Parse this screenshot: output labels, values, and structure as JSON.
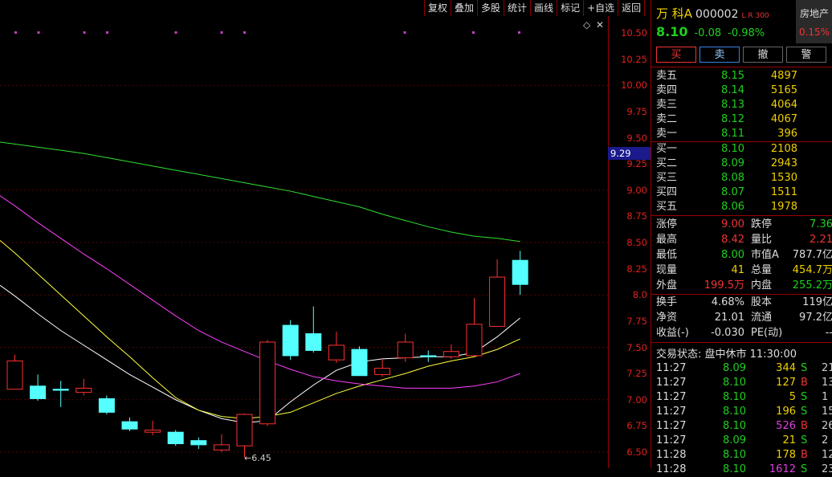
{
  "toolbar": {
    "items": [
      "复权",
      "叠加",
      "多股",
      "统计",
      "画线",
      "标记",
      "+自选",
      "返回"
    ]
  },
  "chart_controls": {
    "diamond": "◇",
    "close": "✕"
  },
  "price_axis": {
    "ticks": [
      "10.50",
      "10.25",
      "10.00",
      "9.75",
      "9.50",
      "9.25",
      "9.00",
      "8.75",
      "8.50",
      "8.25",
      "8.0",
      "7.75",
      "7.50",
      "7.25",
      "7.00",
      "6.75",
      "6.50"
    ],
    "current_label": "9.29"
  },
  "chart_data": {
    "type": "candlestick",
    "y_range": [
      6.45,
      10.6
    ],
    "candles": [
      {
        "o": 7.1,
        "c": 7.37,
        "h": 7.43,
        "l": 7.1
      },
      {
        "o": 7.13,
        "c": 7.01,
        "h": 7.24,
        "l": 6.99
      },
      {
        "o": 7.1,
        "c": 7.09,
        "h": 7.18,
        "l": 6.93
      },
      {
        "o": 7.07,
        "c": 7.11,
        "h": 7.2,
        "l": 7.04
      },
      {
        "o": 7.01,
        "c": 6.88,
        "h": 7.04,
        "l": 6.86
      },
      {
        "o": 6.79,
        "c": 6.72,
        "h": 6.83,
        "l": 6.7
      },
      {
        "o": 6.69,
        "c": 6.71,
        "h": 6.8,
        "l": 6.66
      },
      {
        "o": 6.69,
        "c": 6.58,
        "h": 6.71,
        "l": 6.56
      },
      {
        "o": 6.61,
        "c": 6.57,
        "h": 6.64,
        "l": 6.53
      },
      {
        "o": 6.52,
        "c": 6.57,
        "h": 6.67,
        "l": 6.5
      },
      {
        "o": 6.56,
        "c": 6.86,
        "h": 6.87,
        "l": 6.45
      },
      {
        "o": 6.77,
        "c": 7.55,
        "h": 7.57,
        "l": 6.75
      },
      {
        "o": 7.71,
        "c": 7.42,
        "h": 7.76,
        "l": 7.38
      },
      {
        "o": 7.63,
        "c": 7.47,
        "h": 7.89,
        "l": 7.45
      },
      {
        "o": 7.38,
        "c": 7.52,
        "h": 7.65,
        "l": 7.35
      },
      {
        "o": 7.48,
        "c": 7.23,
        "h": 7.51,
        "l": 7.23
      },
      {
        "o": 7.24,
        "c": 7.3,
        "h": 7.39,
        "l": 7.22
      },
      {
        "o": 7.4,
        "c": 7.55,
        "h": 7.63,
        "l": 7.36
      },
      {
        "o": 7.42,
        "c": 7.41,
        "h": 7.47,
        "l": 7.36
      },
      {
        "o": 7.41,
        "c": 7.46,
        "h": 7.53,
        "l": 7.39
      },
      {
        "o": 7.42,
        "c": 7.72,
        "h": 7.97,
        "l": 7.42
      },
      {
        "o": 7.7,
        "c": 8.17,
        "h": 8.34,
        "l": 7.7
      },
      {
        "o": 8.33,
        "c": 8.1,
        "h": 8.42,
        "l": 8.0
      }
    ],
    "ma_lines": [
      {
        "color": "#ffffff",
        "values": [
          7.99,
          7.82,
          7.66,
          7.52,
          7.38,
          7.24,
          7.12,
          7.0,
          6.9,
          6.82,
          6.78,
          6.8,
          6.98,
          7.14,
          7.28,
          7.36,
          7.39,
          7.4,
          7.41,
          7.41,
          7.45,
          7.6,
          7.78
        ]
      },
      {
        "color": "#ffff40",
        "values": [
          8.4,
          8.2,
          8.0,
          7.8,
          7.6,
          7.41,
          7.21,
          7.02,
          6.9,
          6.84,
          6.82,
          6.84,
          6.88,
          6.97,
          7.06,
          7.13,
          7.19,
          7.25,
          7.32,
          7.37,
          7.41,
          7.48,
          7.58
        ]
      },
      {
        "color": "#ff40ff",
        "values": [
          8.85,
          8.69,
          8.54,
          8.39,
          8.25,
          8.1,
          7.95,
          7.8,
          7.66,
          7.55,
          7.46,
          7.37,
          7.29,
          7.22,
          7.18,
          7.15,
          7.13,
          7.11,
          7.11,
          7.11,
          7.13,
          7.17,
          7.25
        ]
      },
      {
        "color": "#30e030",
        "values": [
          9.44,
          9.41,
          9.38,
          9.35,
          9.31,
          9.27,
          9.23,
          9.19,
          9.15,
          9.11,
          9.07,
          9.03,
          8.99,
          8.94,
          8.89,
          8.84,
          8.77,
          8.71,
          8.65,
          8.6,
          8.56,
          8.54,
          8.51
        ]
      }
    ],
    "low_marker": "6.45"
  },
  "stock": {
    "name": "万 科A",
    "code": "000002",
    "flags": "L R 300",
    "sector": "房地产",
    "sector_change": "0.15%",
    "price": "8.10",
    "change": "-0.08",
    "change_pct": "-0.98%"
  },
  "trade_buttons": [
    "买",
    "卖",
    "撤",
    "警"
  ],
  "order_book": [
    {
      "label": "卖五",
      "price": "8.15",
      "vol": "4897",
      "color": "#1fd01f"
    },
    {
      "label": "卖四",
      "price": "8.14",
      "vol": "5165",
      "color": "#1fd01f"
    },
    {
      "label": "卖三",
      "price": "8.13",
      "vol": "4064",
      "color": "#1fd01f"
    },
    {
      "label": "卖二",
      "price": "8.12",
      "vol": "4067",
      "color": "#1fd01f"
    },
    {
      "label": "卖一",
      "price": "8.11",
      "vol": "396",
      "color": "#1fd01f"
    },
    {
      "label": "买一",
      "price": "8.10",
      "vol": "2108",
      "color": "#1fd01f"
    },
    {
      "label": "买二",
      "price": "8.09",
      "vol": "2943",
      "color": "#1fd01f"
    },
    {
      "label": "买三",
      "price": "8.08",
      "vol": "1530",
      "color": "#1fd01f"
    },
    {
      "label": "买四",
      "price": "8.07",
      "vol": "1511",
      "color": "#1fd01f"
    },
    {
      "label": "买五",
      "price": "8.06",
      "vol": "1978",
      "color": "#1fd01f"
    }
  ],
  "stats_a": [
    {
      "l1": "涨停",
      "v1": "9.00",
      "c1": "#e33",
      "l2": "跌停",
      "v2": "7.36",
      "c2": "#1fd01f"
    },
    {
      "l1": "最高",
      "v1": "8.42",
      "c1": "#e33",
      "l2": "量比",
      "v2": "2.21",
      "c2": "#e33"
    },
    {
      "l1": "最低",
      "v1": "8.00",
      "c1": "#1fd01f",
      "l2": "市值A",
      "v2": "787.7亿",
      "c2": "#ddd"
    },
    {
      "l1": "现量",
      "v1": "41",
      "c1": "#f0d000",
      "l2": "总量",
      "v2": "454.7万",
      "c2": "#f0d000"
    },
    {
      "l1": "外盘",
      "v1": "199.5万",
      "c1": "#e33",
      "l2": "内盘",
      "v2": "255.2万",
      "c2": "#1fd01f"
    }
  ],
  "stats_b": [
    {
      "l1": "换手",
      "v1": "4.68%",
      "c1": "#ddd",
      "l2": "股本",
      "v2": "119亿",
      "c2": "#ddd"
    },
    {
      "l1": "净资",
      "v1": "21.01",
      "c1": "#ddd",
      "l2": "流通",
      "v2": "97.2亿",
      "c2": "#ddd"
    },
    {
      "l1": "收益(-)",
      "v1": "-0.030",
      "c1": "#ddd",
      "l2": "PE(动)",
      "v2": "--",
      "c2": "#ddd"
    }
  ],
  "trade_status": "交易状态: 盘中休市 11:30:00",
  "ticks": [
    {
      "time": "11:27",
      "price": "8.09",
      "vol": "344",
      "side": "S",
      "cnt": "21",
      "pc": "#1fd01f",
      "vc": "#f0d000",
      "sc": "#1fd01f"
    },
    {
      "time": "11:27",
      "price": "8.10",
      "vol": "127",
      "side": "B",
      "cnt": "13",
      "pc": "#1fd01f",
      "vc": "#f0d000",
      "sc": "#e33"
    },
    {
      "time": "11:27",
      "price": "8.10",
      "vol": "5",
      "side": "S",
      "cnt": "1",
      "pc": "#1fd01f",
      "vc": "#f0d000",
      "sc": "#1fd01f"
    },
    {
      "time": "11:27",
      "price": "8.10",
      "vol": "196",
      "side": "S",
      "cnt": "15",
      "pc": "#1fd01f",
      "vc": "#f0d000",
      "sc": "#1fd01f"
    },
    {
      "time": "11:27",
      "price": "8.10",
      "vol": "526",
      "side": "B",
      "cnt": "26",
      "pc": "#1fd01f",
      "vc": "#e040e0",
      "sc": "#e33"
    },
    {
      "time": "11:27",
      "price": "8.09",
      "vol": "21",
      "side": "S",
      "cnt": "2",
      "pc": "#1fd01f",
      "vc": "#f0d000",
      "sc": "#1fd01f"
    },
    {
      "time": "11:28",
      "price": "8.10",
      "vol": "178",
      "side": "B",
      "cnt": "12",
      "pc": "#1fd01f",
      "vc": "#f0d000",
      "sc": "#e33"
    },
    {
      "time": "11:28",
      "price": "8.10",
      "vol": "1612",
      "side": "S",
      "cnt": "23",
      "pc": "#1fd01f",
      "vc": "#e040e0",
      "sc": "#1fd01f"
    }
  ]
}
